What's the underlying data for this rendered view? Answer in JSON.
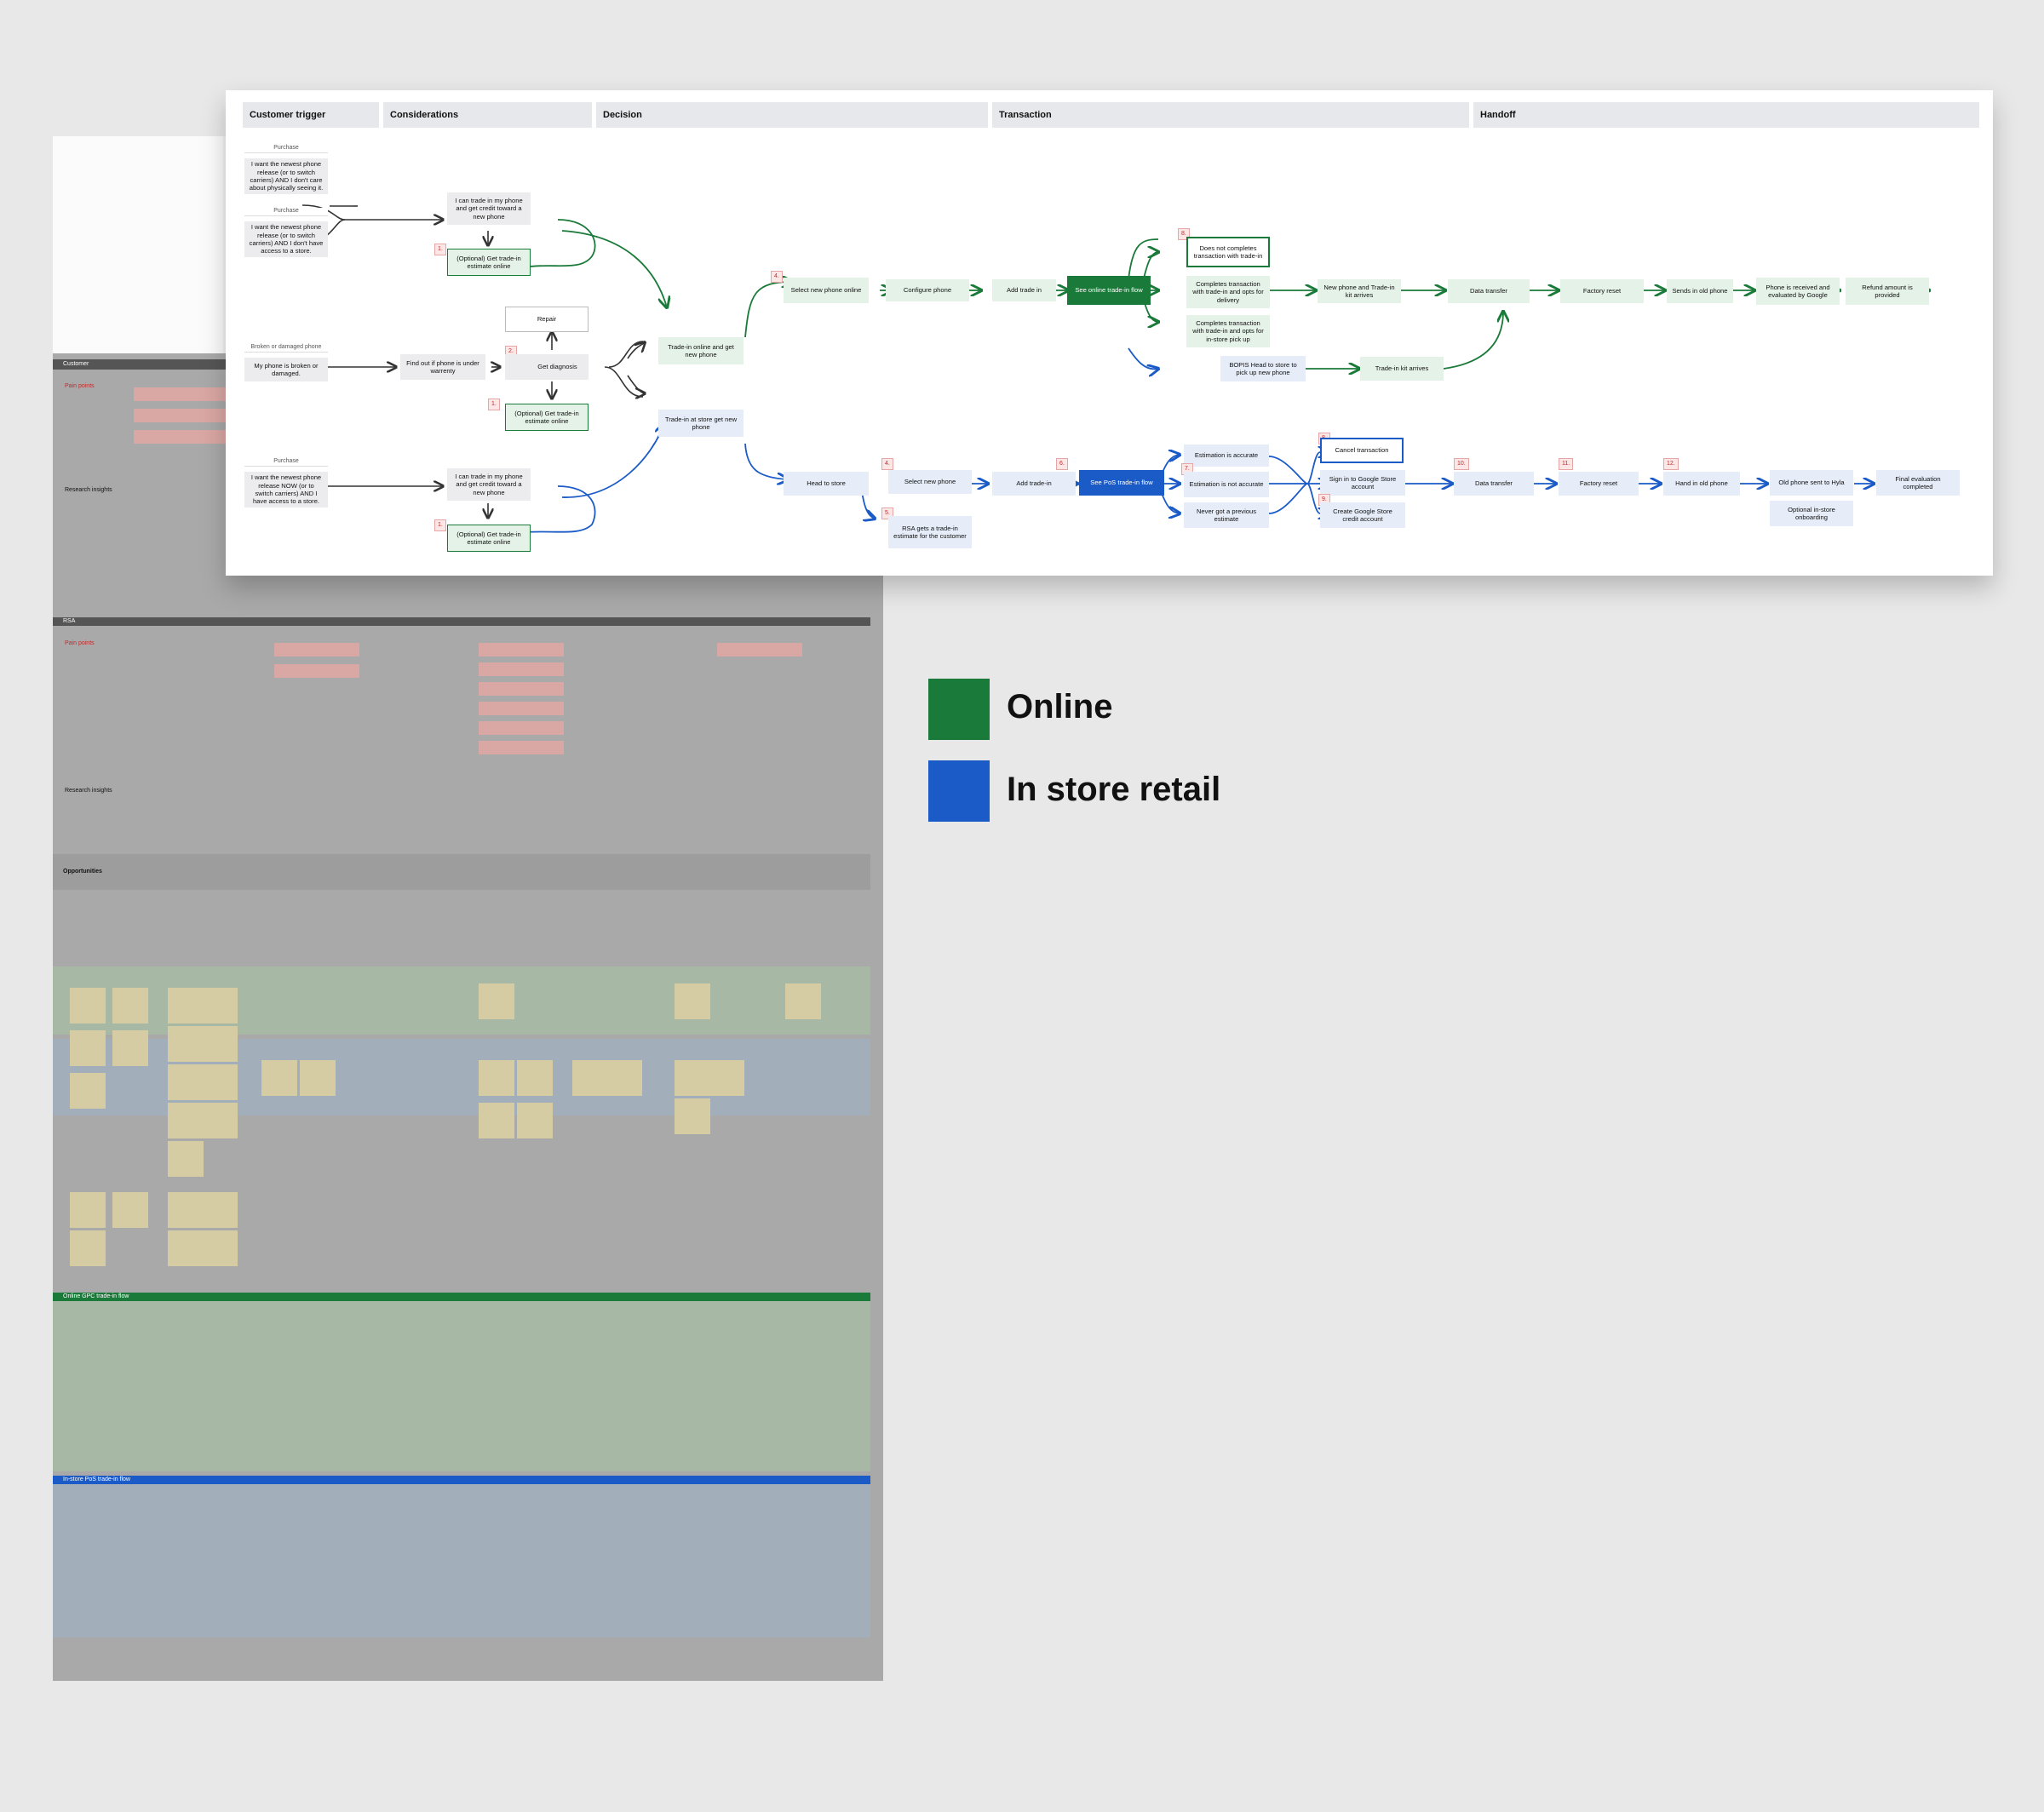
{
  "legend": [
    {
      "label": "Online",
      "color": "#1a7a39"
    },
    {
      "label": "In store retail",
      "color": "#1a5bc7"
    }
  ],
  "colors": {
    "online": "#1a7a39",
    "in_store": "#1a5bc7",
    "neutral": "#333333"
  },
  "columns": [
    "Customer trigger",
    "Considerations",
    "Decision",
    "Transaction",
    "Handoff"
  ],
  "triggers": {
    "purchase_tag": "Purchase",
    "t1": "I want the newest phone release (or to switch carriers) AND I don't care about physically seeing it.",
    "t2": "I want the newest phone release (or to switch carriers) AND I don't have access to a store.",
    "broken_tag": "Broken or damaged phone",
    "t3": "My phone is broken or damaged.",
    "t4": "I want the newest phone release NOW (or to switch carriers) AND I have access to a store."
  },
  "considerations": {
    "credit": "I can trade in my phone and get credit toward a new phone",
    "optional": "(Optional) Get trade-in estimate online",
    "repair": "Repair",
    "warranty": "Find out if phone is under warrenty",
    "diagnosis": "Get diagnosis"
  },
  "decision": {
    "online": "Trade-in online and get new phone",
    "store": "Trade-in at store get new phone"
  },
  "online_flow": {
    "select": "Select new phone online",
    "configure": "Configure phone",
    "add": "Add trade in",
    "see_flow": "See online trade-in flow",
    "not_complete": "Does not completes transaction with trade-in",
    "delivery": "Completes transaction with trade-in and opts for delivery",
    "pickup": "Completes transaction with trade-in and opts for in-store pick up",
    "bopis": "BOPIS Head to store to pick up new phone",
    "kit_arrives": "Trade-in kit arrives",
    "new_phone_kit": "New phone and Trade-in kit arrives",
    "data_transfer": "Data transfer",
    "factory_reset": "Factory reset",
    "sends_old": "Sends in old phone",
    "received": "Phone is received and evaluated by Google",
    "refund": "Refund amount is provided"
  },
  "store_flow": {
    "head": "Head to store",
    "select": "Select new phone",
    "rsa_estimate": "RSA gets a trade-in estimate for the customer",
    "add": "Add trade-in",
    "see_flow": "See PoS trade-in flow",
    "accurate": "Estimation is accurate",
    "not_accurate": "Estimation is not accurate",
    "never": "Never got a previous estimate",
    "cancel": "Cancel transaction",
    "sign_in": "Sign in to Google Store account",
    "create": "Create Google Store credit account",
    "data_transfer": "Data transfer",
    "factory_reset": "Factory reset",
    "hand_in": "Hand in old phone",
    "sent_hyla": "Old phone sent to Hyla",
    "onboarding": "Optional in-store onboarding",
    "final": "Final evaluation completed"
  },
  "pain_tags": {
    "a": "1.",
    "b": "2.",
    "c": "3.",
    "d": "4.",
    "e": "5.",
    "f": "6.",
    "g": "7.",
    "h": "8.",
    "i": "9.",
    "j": "10.",
    "k": "11.",
    "l": "12."
  },
  "background_board": {
    "customer_band": "Customer",
    "pain_points": "Pain points",
    "research": "Research insights",
    "rsa": "RSA",
    "opportunities": "Opportunities",
    "opp_cols": [
      "Considerations",
      "Decision",
      "Transaction",
      "Handoff"
    ],
    "online_flow_band": "Online GPC trade-in flow",
    "instore_flow_band": "In-store PoS trade-in flow"
  }
}
